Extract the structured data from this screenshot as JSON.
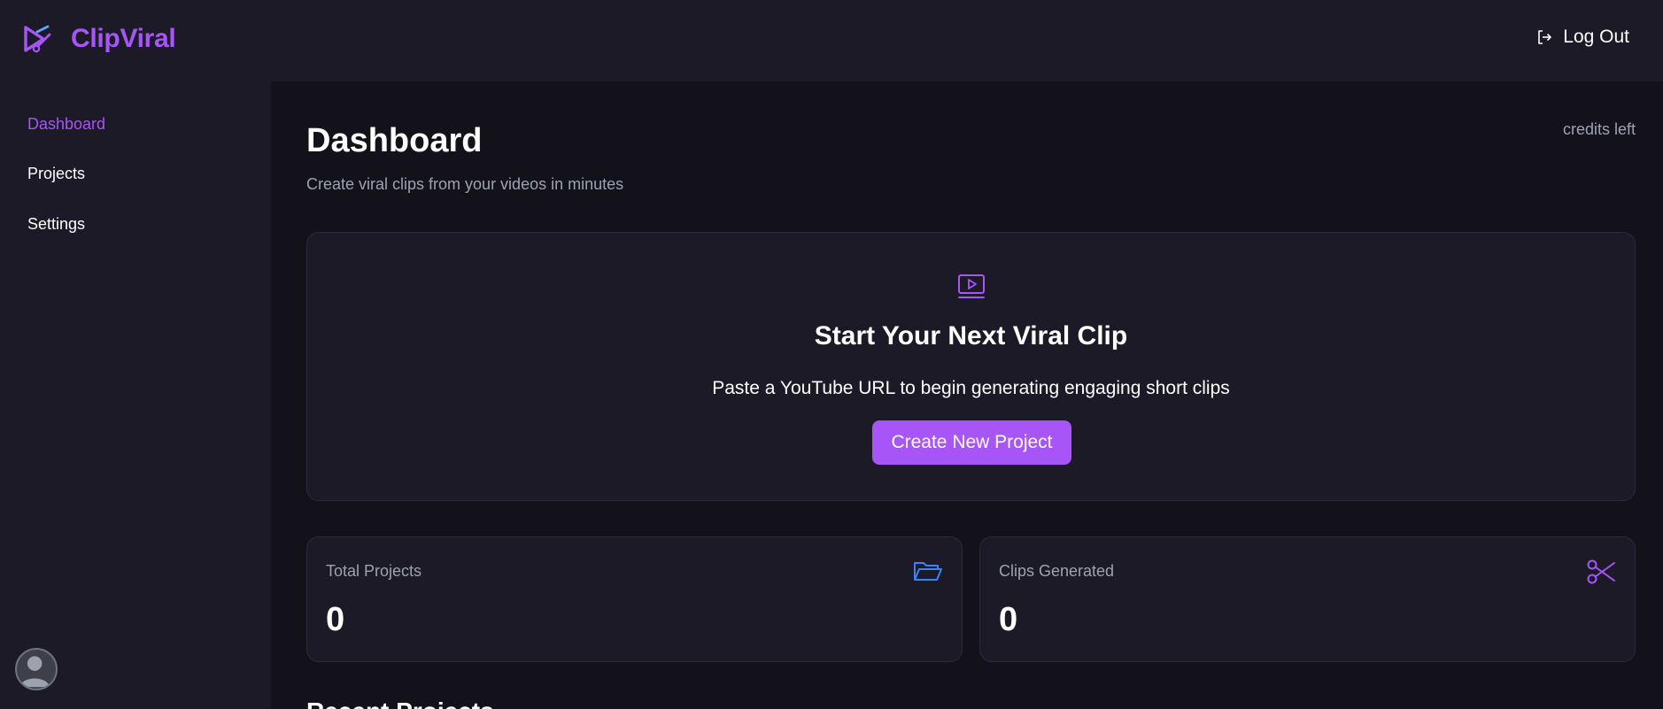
{
  "app": {
    "name": "ClipViral"
  },
  "header": {
    "logout_label": "Log Out"
  },
  "sidebar": {
    "items": [
      {
        "label": "Dashboard",
        "active": true
      },
      {
        "label": "Projects",
        "active": false
      },
      {
        "label": "Settings",
        "active": false
      }
    ]
  },
  "page": {
    "title": "Dashboard",
    "subtitle": "Create viral clips from your videos in minutes",
    "credits": "credits left"
  },
  "hero": {
    "title": "Start Your Next Viral Clip",
    "description": "Paste a YouTube URL to begin generating engaging short clips",
    "button_label": "Create New Project",
    "icon": "video-play-icon"
  },
  "stats": [
    {
      "label": "Total Projects",
      "value": "0",
      "icon": "folder-open-icon",
      "icon_color": "#3b82f6"
    },
    {
      "label": "Clips Generated",
      "value": "0",
      "icon": "scissors-icon",
      "icon_color": "#a855f7"
    }
  ],
  "recent": {
    "heading": "Recent Projects"
  },
  "colors": {
    "accent": "#a855f7",
    "background": "#13121b",
    "panel": "#1b1a26",
    "muted_text": "#9ca3af"
  }
}
